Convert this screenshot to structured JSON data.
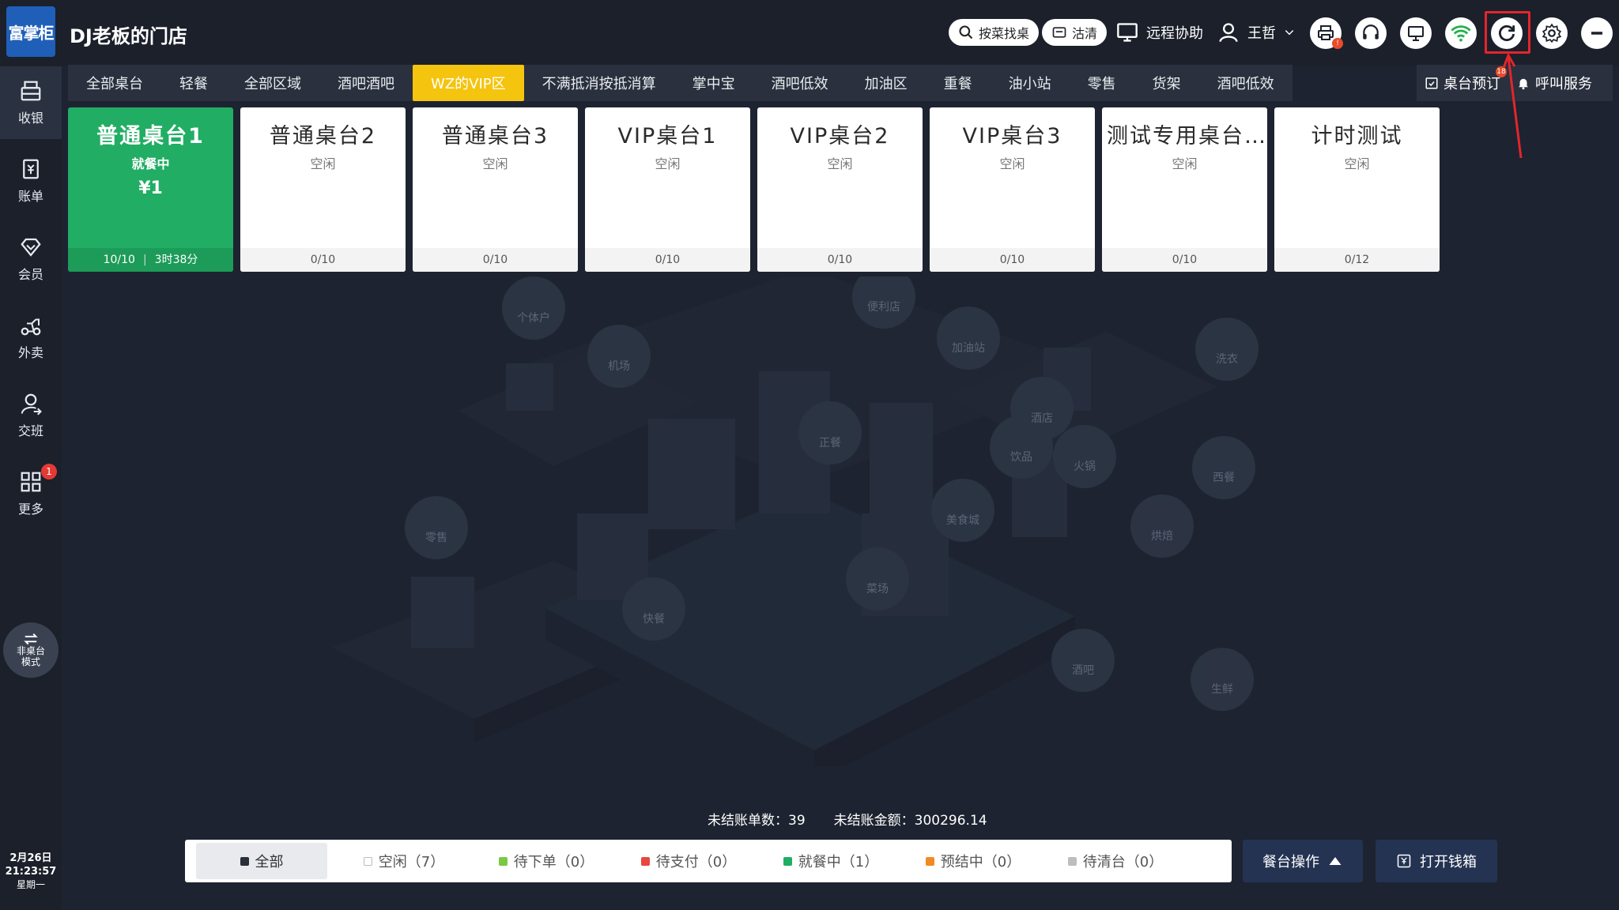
{
  "app": {
    "logo_text": "富掌柜",
    "store_name": "DJ老板的门店"
  },
  "header": {
    "search_dish": "按菜找桌",
    "clean": "沽清",
    "remote_assist": "远程协助",
    "user_name": "王哲",
    "print_badge": "!",
    "refresh_badge": "18",
    "icons": [
      "print-icon",
      "headset-icon",
      "monitor-icon",
      "wifi-icon",
      "refresh-icon",
      "settings-icon",
      "minimize-icon"
    ]
  },
  "sidebar": {
    "items": [
      {
        "label": "收银",
        "icon": "cashier-icon"
      },
      {
        "label": "账单",
        "icon": "bill-icon"
      },
      {
        "label": "会员",
        "icon": "member-icon"
      },
      {
        "label": "外卖",
        "icon": "delivery-icon"
      },
      {
        "label": "交班",
        "icon": "shift-icon"
      },
      {
        "label": "更多",
        "icon": "grid-icon",
        "badge": "1"
      }
    ],
    "mode_line1": "非桌台",
    "mode_line2": "模式",
    "date": "2月26日",
    "time": "21:23:57",
    "weekday": "星期一"
  },
  "tabs": [
    "全部桌台",
    "轻餐",
    "全部区域",
    "酒吧酒吧",
    "WZ的VIP区",
    "不满抵消按抵消算",
    "掌中宝",
    "酒吧低效",
    "加油区",
    "重餐",
    "油小站",
    "零售",
    "货架",
    "酒吧低效"
  ],
  "active_tab": 4,
  "right_actions": {
    "reserve": "桌台预订",
    "call_service": "呼叫服务"
  },
  "tables": [
    {
      "name": "普通桌台1",
      "status": "就餐中",
      "amount": "¥1",
      "seats": "10/10",
      "duration": "3时38分",
      "busy": true
    },
    {
      "name": "普通桌台2",
      "status": "空闲",
      "seats": "0/10"
    },
    {
      "name": "普通桌台3",
      "status": "空闲",
      "seats": "0/10"
    },
    {
      "name": "VIP桌台1",
      "status": "空闲",
      "seats": "0/10"
    },
    {
      "name": "VIP桌台2",
      "status": "空闲",
      "seats": "0/10"
    },
    {
      "name": "VIP桌台3",
      "status": "空闲",
      "seats": "0/10"
    },
    {
      "name": "测试专用桌台…",
      "status": "空闲",
      "seats": "0/10"
    },
    {
      "name": "计时测试",
      "status": "空闲",
      "seats": "0/12"
    }
  ],
  "summary": {
    "unsettled_count": "未结账单数：39",
    "unsettled_amount": "未结账金额：300296.14"
  },
  "filters": [
    {
      "label": "全部",
      "color": "#2b2f3a"
    },
    {
      "label": "空闲（7）",
      "color": "#ffffff"
    },
    {
      "label": "待下单（0）",
      "color": "#7ac943"
    },
    {
      "label": "待支付（0）",
      "color": "#e8473f"
    },
    {
      "label": "就餐中（1）",
      "color": "#21ad64"
    },
    {
      "label": "预结中（0）",
      "color": "#f08a24"
    },
    {
      "label": "待清台（0）",
      "color": "#bdbdbd"
    }
  ],
  "bottom_buttons": {
    "table_ops": "餐台操作",
    "open_drawer": "打开钱箱"
  },
  "city_labels": [
    "个体户",
    "便利店",
    "机场",
    "加油站",
    "洗衣",
    "酒店",
    "正餐",
    "饮品",
    "火锅",
    "西餐",
    "零售",
    "美食城",
    "烘焙",
    "快餐",
    "菜场",
    "酒吧",
    "生鲜"
  ],
  "colors": {
    "accent_tab": "#f4c40f",
    "busy_table": "#21ad64",
    "highlight": "#e4252c"
  }
}
